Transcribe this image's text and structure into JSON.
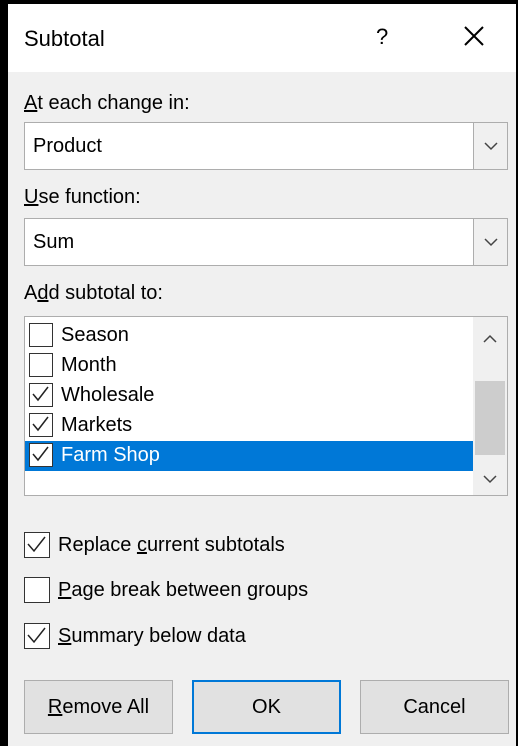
{
  "dialog": {
    "title": "Subtotal",
    "help_label": "?",
    "change_label_accel": "A",
    "change_label_rest": "t each change in:",
    "change_value": "Product",
    "function_label_accel": "U",
    "function_label_rest": "se function:",
    "function_value": "Sum",
    "add_label_pre": "A",
    "add_label_accel": "d",
    "add_label_rest": "d subtotal to:",
    "list_items": [
      {
        "label": "Season",
        "checked": false,
        "selected": false
      },
      {
        "label": "Month",
        "checked": false,
        "selected": false
      },
      {
        "label": "Wholesale",
        "checked": true,
        "selected": false
      },
      {
        "label": "Markets",
        "checked": true,
        "selected": false
      },
      {
        "label": "Farm Shop",
        "checked": true,
        "selected": true
      }
    ],
    "replace_pre": "Replace ",
    "replace_accel": "c",
    "replace_rest": "urrent subtotals",
    "replace_checked": true,
    "pagebreak_accel": "P",
    "pagebreak_rest": "age break between groups",
    "pagebreak_checked": false,
    "summary_accel": "S",
    "summary_rest": "ummary below data",
    "summary_checked": true,
    "remove_all_accel": "R",
    "remove_all_rest": "emove All",
    "ok_label": "OK",
    "cancel_label": "Cancel",
    "accent_color": "#0078d7"
  }
}
